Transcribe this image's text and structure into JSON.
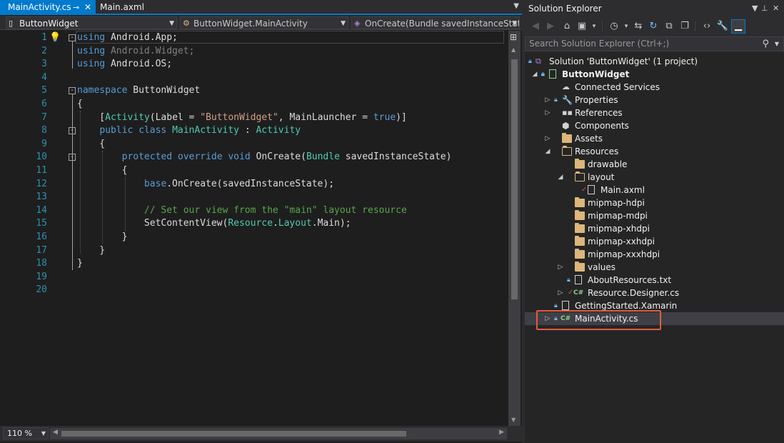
{
  "editor": {
    "tabs": [
      {
        "label": "MainActivity.cs",
        "pin": "⊸",
        "close": "✕"
      },
      {
        "label": "Main.axml"
      }
    ],
    "tab_dropdown": "▼",
    "navbar": {
      "project": "ButtonWidget",
      "class": "ButtonWidget.MainActivity",
      "member": "OnCreate(Bundle savedInstanceState)"
    },
    "line_numbers": [
      "1",
      "2",
      "3",
      "4",
      "5",
      "6",
      "7",
      "8",
      "9",
      "10",
      "11",
      "12",
      "13",
      "14",
      "15",
      "16",
      "17",
      "18",
      "19",
      "20"
    ],
    "zoom": "110 %"
  },
  "solution_explorer": {
    "title": "Solution Explorer",
    "pin_label": "⊥",
    "close_label": "✕",
    "dropdown_label": "▼",
    "search_placeholder": "Search Solution Explorer (Ctrl+;)",
    "items": [
      {
        "label": "Solution 'ButtonWidget' (1 project)",
        "icon": "solution-icon"
      },
      {
        "label": "ButtonWidget",
        "icon": "project-icon"
      },
      {
        "label": "Connected Services",
        "icon": "cloud-icon"
      },
      {
        "label": "Properties",
        "icon": "wrench-icon"
      },
      {
        "label": "References",
        "icon": "references-icon"
      },
      {
        "label": "Components",
        "icon": "cube-icon"
      },
      {
        "label": "Assets",
        "icon": "folder-icon"
      },
      {
        "label": "Resources",
        "icon": "folder-open-icon"
      },
      {
        "label": "drawable",
        "icon": "folder-icon"
      },
      {
        "label": "layout",
        "icon": "folder-open-icon"
      },
      {
        "label": "Main.axml",
        "icon": "file-icon"
      },
      {
        "label": "mipmap-hdpi",
        "icon": "folder-icon"
      },
      {
        "label": "mipmap-mdpi",
        "icon": "folder-icon"
      },
      {
        "label": "mipmap-xhdpi",
        "icon": "folder-icon"
      },
      {
        "label": "mipmap-xxhdpi",
        "icon": "folder-icon"
      },
      {
        "label": "mipmap-xxxhdpi",
        "icon": "folder-icon"
      },
      {
        "label": "values",
        "icon": "folder-icon"
      },
      {
        "label": "AboutResources.txt",
        "icon": "file-icon"
      },
      {
        "label": "Resource.Designer.cs",
        "icon": "csharp-icon"
      },
      {
        "label": "GettingStarted.Xamarin",
        "icon": "file-icon"
      },
      {
        "label": "MainActivity.cs",
        "icon": "csharp-icon",
        "selected": true
      }
    ]
  },
  "colors": {
    "accent": "#007acc",
    "highlight_box": "#e05c3a",
    "keyword": "#569cd6",
    "type": "#4ec9b0",
    "string": "#d69d85",
    "comment": "#57a64a"
  }
}
